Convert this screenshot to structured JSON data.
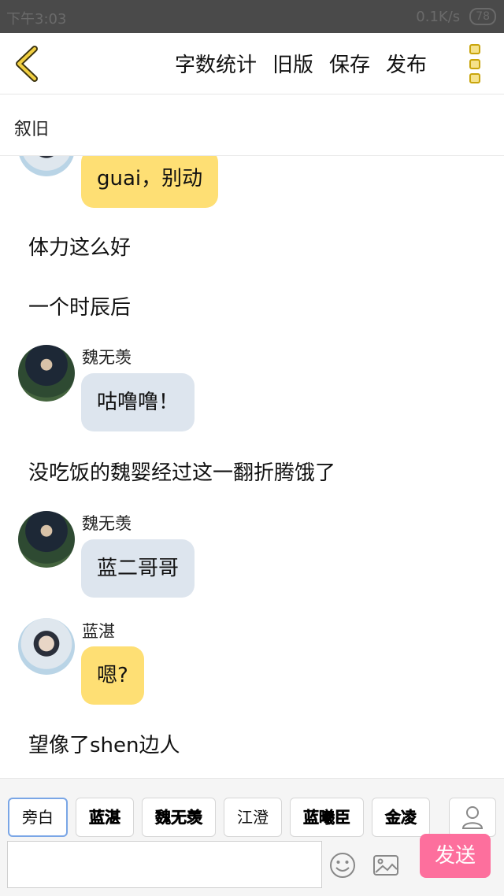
{
  "status": {
    "time": "下午3:03",
    "net": "0.1K/s",
    "battery": "78"
  },
  "header": {
    "actions": [
      "字数统计",
      "旧版",
      "保存",
      "发布"
    ]
  },
  "title": "叙旧",
  "chat": {
    "partial_bubble": "guai，别动",
    "narration_1": "体力这么好",
    "narration_2": "一个时辰后",
    "msg_1": {
      "speaker": "魏无羡",
      "text": "咕噜噜！"
    },
    "narration_3": "没吃饭的魏婴经过这一翻折腾饿了",
    "msg_2": {
      "speaker": "魏无羡",
      "text": "蓝二哥哥"
    },
    "msg_3": {
      "speaker": "蓝湛",
      "text": "嗯?"
    },
    "narration_4": "望像了shen边人"
  },
  "characters": [
    "旁白",
    "蓝湛",
    "魏无羡",
    "江澄",
    "蓝曦臣",
    "金凌"
  ],
  "input": {
    "value": "",
    "placeholder": ""
  },
  "send_label": "发送",
  "colors": {
    "accent": "#fd6f9d",
    "bubble_yellow": "#fedf74",
    "bubble_blue": "#dde5ee",
    "back_icon": "#d4a90c"
  },
  "icons": [
    "chevron-left-icon",
    "more-icon",
    "user-icon",
    "emoji-icon",
    "image-icon"
  ]
}
